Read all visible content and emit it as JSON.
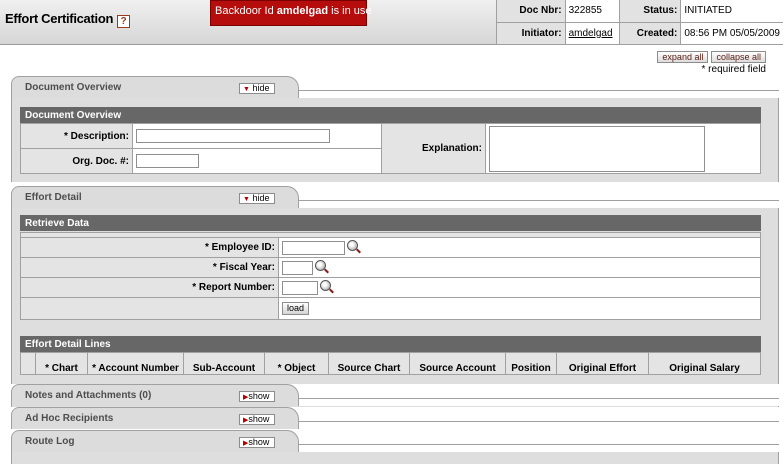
{
  "header": {
    "title": "Effort Certification",
    "help": "?",
    "backdoor": {
      "prefix": "Backdoor Id ",
      "user": "amdelgad",
      "suffix": " is in use"
    },
    "doc_nbr_label": "Doc Nbr:",
    "doc_nbr": "322855",
    "status_label": "Status:",
    "status": "INITIATED",
    "initiator_label": "Initiator:",
    "initiator": "amdelgad",
    "created_label": "Created:",
    "created": "08:56 PM 05/05/2009"
  },
  "controls": {
    "expand_all": "expand all",
    "collapse_all": "collapse all",
    "required_note": "* required field"
  },
  "tabs": {
    "document_overview": {
      "label": "Document Overview",
      "button": "hide"
    },
    "effort_detail": {
      "label": "Effort Detail",
      "button": "hide"
    },
    "notes": {
      "label": "Notes and Attachments (0)",
      "button": "show"
    },
    "adhoc": {
      "label": "Ad Hoc Recipients",
      "button": "show"
    },
    "route_log": {
      "label": "Route Log",
      "button": "show"
    }
  },
  "document_overview": {
    "section_title": "Document Overview",
    "description_label": "* Description:",
    "description_value": "",
    "org_doc_label": "Org. Doc. #:",
    "org_doc_value": "",
    "explanation_label": "Explanation:",
    "explanation_value": ""
  },
  "retrieve_data": {
    "section_title": "Retrieve Data",
    "employee_id_label": "* Employee ID:",
    "fiscal_year_label": "* Fiscal Year:",
    "report_number_label": "* Report Number:",
    "load_button": "load"
  },
  "effort_detail_lines": {
    "section_title": "Effort Detail Lines",
    "columns": [
      "* Chart",
      "* Account Number",
      "Sub-Account",
      "* Object",
      "Source Chart",
      "Source Account",
      "Position",
      "Original Effort",
      "Original Salary"
    ]
  }
}
